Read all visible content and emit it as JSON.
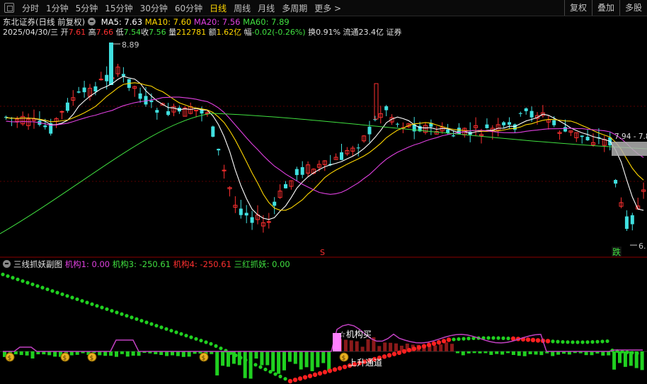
{
  "toolbar": {
    "periods": [
      "分时",
      "1分钟",
      "5分钟",
      "15分钟",
      "30分钟",
      "60分钟",
      "日线",
      "周线",
      "月线",
      "多周期",
      "更多 >"
    ],
    "active_period": "日线",
    "right_buttons": [
      "复权",
      "叠加",
      "多股"
    ]
  },
  "main_chart": {
    "stock_name": "东北证券(日线 前复权)",
    "ma_labels": [
      {
        "text": "MA5: 7.63",
        "color": "#ffffff"
      },
      {
        "text": "MA10: 7.60",
        "color": "#ffd700"
      },
      {
        "text": "MA20: 7.56",
        "color": "#e040e0"
      },
      {
        "text": "MA60: 7.89",
        "color": "#40e040"
      }
    ],
    "quote": {
      "date": "2025/04/30/三",
      "open_label": "开",
      "open": "7.61",
      "high_label": "高",
      "high": "7.66",
      "low_label": "低",
      "low": "7.54",
      "close_label": "收",
      "close": "7.56",
      "volume_label": "量",
      "volume": "212781",
      "amount_label": "额",
      "amount": "1.62亿",
      "change_label": "幅",
      "change": "-0.02(-0.26%)",
      "turnover_label": "换",
      "turnover": "0.91%",
      "float_label": "流通",
      "float": "23.4亿",
      "sector": "证券"
    },
    "high_marker": "8.89",
    "right_price_label": "7.94 - 7.8",
    "low_marker": "6.",
    "signal_s": "S",
    "signal_die": "跌"
  },
  "sub_chart": {
    "title": "三线抓妖副图",
    "values": [
      {
        "text": "机构1: 0.00",
        "color": "#e040e0"
      },
      {
        "text": "机构3: -250.61",
        "color": "#40e040"
      },
      {
        "text": "机构4: -250.61",
        "color": "#ff3030"
      },
      {
        "text": "三红抓妖: 0.00",
        "color": "#40e040"
      }
    ],
    "annotations": [
      "☆机构买",
      "上升通道"
    ],
    "coin_icon_count": 5
  },
  "colors": {
    "up": "#ff3030",
    "down": "#40e0e0",
    "ma5": "#ffffff",
    "ma10": "#ffd700",
    "ma20": "#e040e0",
    "ma60": "#40e040",
    "green_dots": "#20d020",
    "red_dots": "#ff2020",
    "background": "#000000"
  }
}
